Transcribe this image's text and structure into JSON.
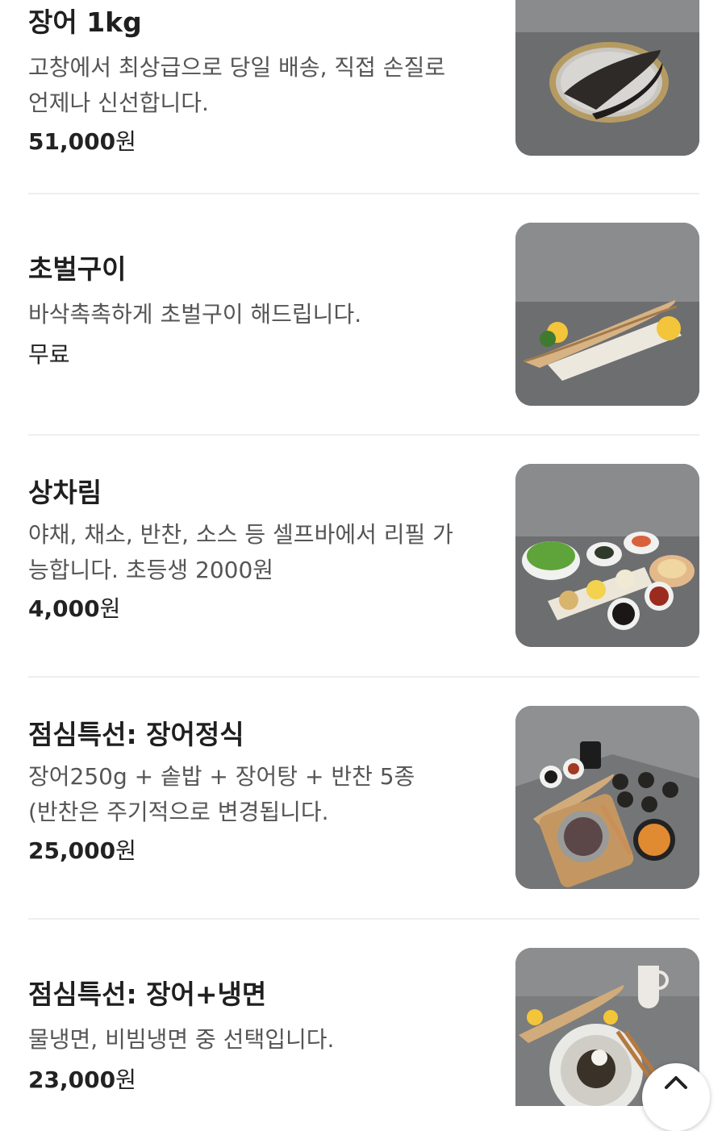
{
  "menu": {
    "items": [
      {
        "name": "장어 1kg",
        "desc_lines": [
          "고창에서 최상급으로 당일 배송, 직접 손질로",
          "언제나 신선합니다."
        ],
        "price": "51,000",
        "unit": "원",
        "photo": "eel-on-basket-photo"
      },
      {
        "name": "초벌구이",
        "desc_lines": [
          "바삭촉촉하게 초벌구이 해드립니다."
        ],
        "price": "무료",
        "unit": "",
        "photo": "grilled-eel-plate-photo"
      },
      {
        "name": "상차림",
        "desc_lines": [
          "야채, 채소, 반찬, 소스 등 셀프바에서 리필 가",
          "능합니다. 초등생 2000원"
        ],
        "price": "4,000",
        "unit": "원",
        "photo": "side-dishes-photo"
      },
      {
        "name": "점심특선: 장어정식",
        "desc_lines": [
          "장어250g + 솥밥 + 장어탕 + 반찬 5종",
          "(반찬은 주기적으로 변경됩니다."
        ],
        "price": "25,000",
        "unit": "원",
        "photo": "eel-set-meal-photo"
      },
      {
        "name": "점심특선: 장어+냉면",
        "desc_lines": [
          "물냉면, 비빔냉면 중 선택입니다."
        ],
        "price": "23,000",
        "unit": "원",
        "photo": "eel-cold-noodle-photo"
      }
    ]
  },
  "colors": {
    "name": "#1f1f1f",
    "desc": "#555555",
    "divider": "#eeeeee",
    "photo_bg": "#6f7073"
  },
  "scroll_top_icon": "chevron-up-icon"
}
